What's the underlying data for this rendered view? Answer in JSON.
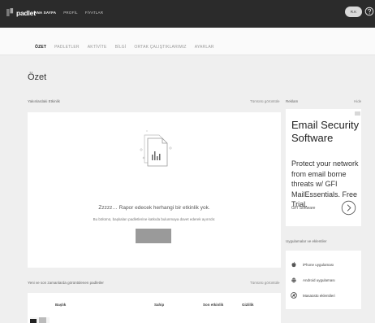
{
  "header": {
    "logo_text": "padlet",
    "nav": [
      "ANA SAYFA",
      "PROFİL",
      "FİYATLAR"
    ],
    "user_badge": "R.K"
  },
  "tabs": [
    "ÖZET",
    "PADLETLER",
    "AKTİVİTE",
    "BİLGİ",
    "ORTAK ÇALIŞTIKLARIMIZ",
    "AYARLAR"
  ],
  "page_title": "Özet",
  "activity": {
    "label": "Yakınlardaki Etkinlik",
    "show_all": "Tümünü görüntüle",
    "empty_title": "Zzzzz… Rapor edecek herhangi bir etkinlik yok.",
    "empty_subtitle": "Bu bölümü, başkaları padletlerine katkıda bulunmaya davet ederek ayırırdır.",
    "button_label": ""
  },
  "recent": {
    "label": "Yeni ve son zamanlarda görüntülenen padletler",
    "show_all": "Tümünü görüntüle",
    "columns": [
      "Başlık",
      "Sahip",
      "Son etkinlik",
      "Gizlilik"
    ]
  },
  "ad": {
    "label": "Reklam",
    "hide": "Hide",
    "title": "Email Security Software",
    "body": "Protect your network from email borne threats w/ GFI MailEssentials. Free Trial.",
    "source": "GFI Software"
  },
  "apps": {
    "label": "Uygulamalar ve eklentiler",
    "items": [
      {
        "label": "iPhone uygulaması",
        "icon": "apple-icon"
      },
      {
        "label": "Android uygulaması",
        "icon": "android-icon"
      },
      {
        "label": "Masaüstü eklentileri",
        "icon": "chrome-icon"
      }
    ]
  },
  "colors": {
    "topbar": "#2b2b2b",
    "page_bg": "#efefef",
    "card_bg": "#ffffff",
    "button": "#9a9a9a"
  }
}
